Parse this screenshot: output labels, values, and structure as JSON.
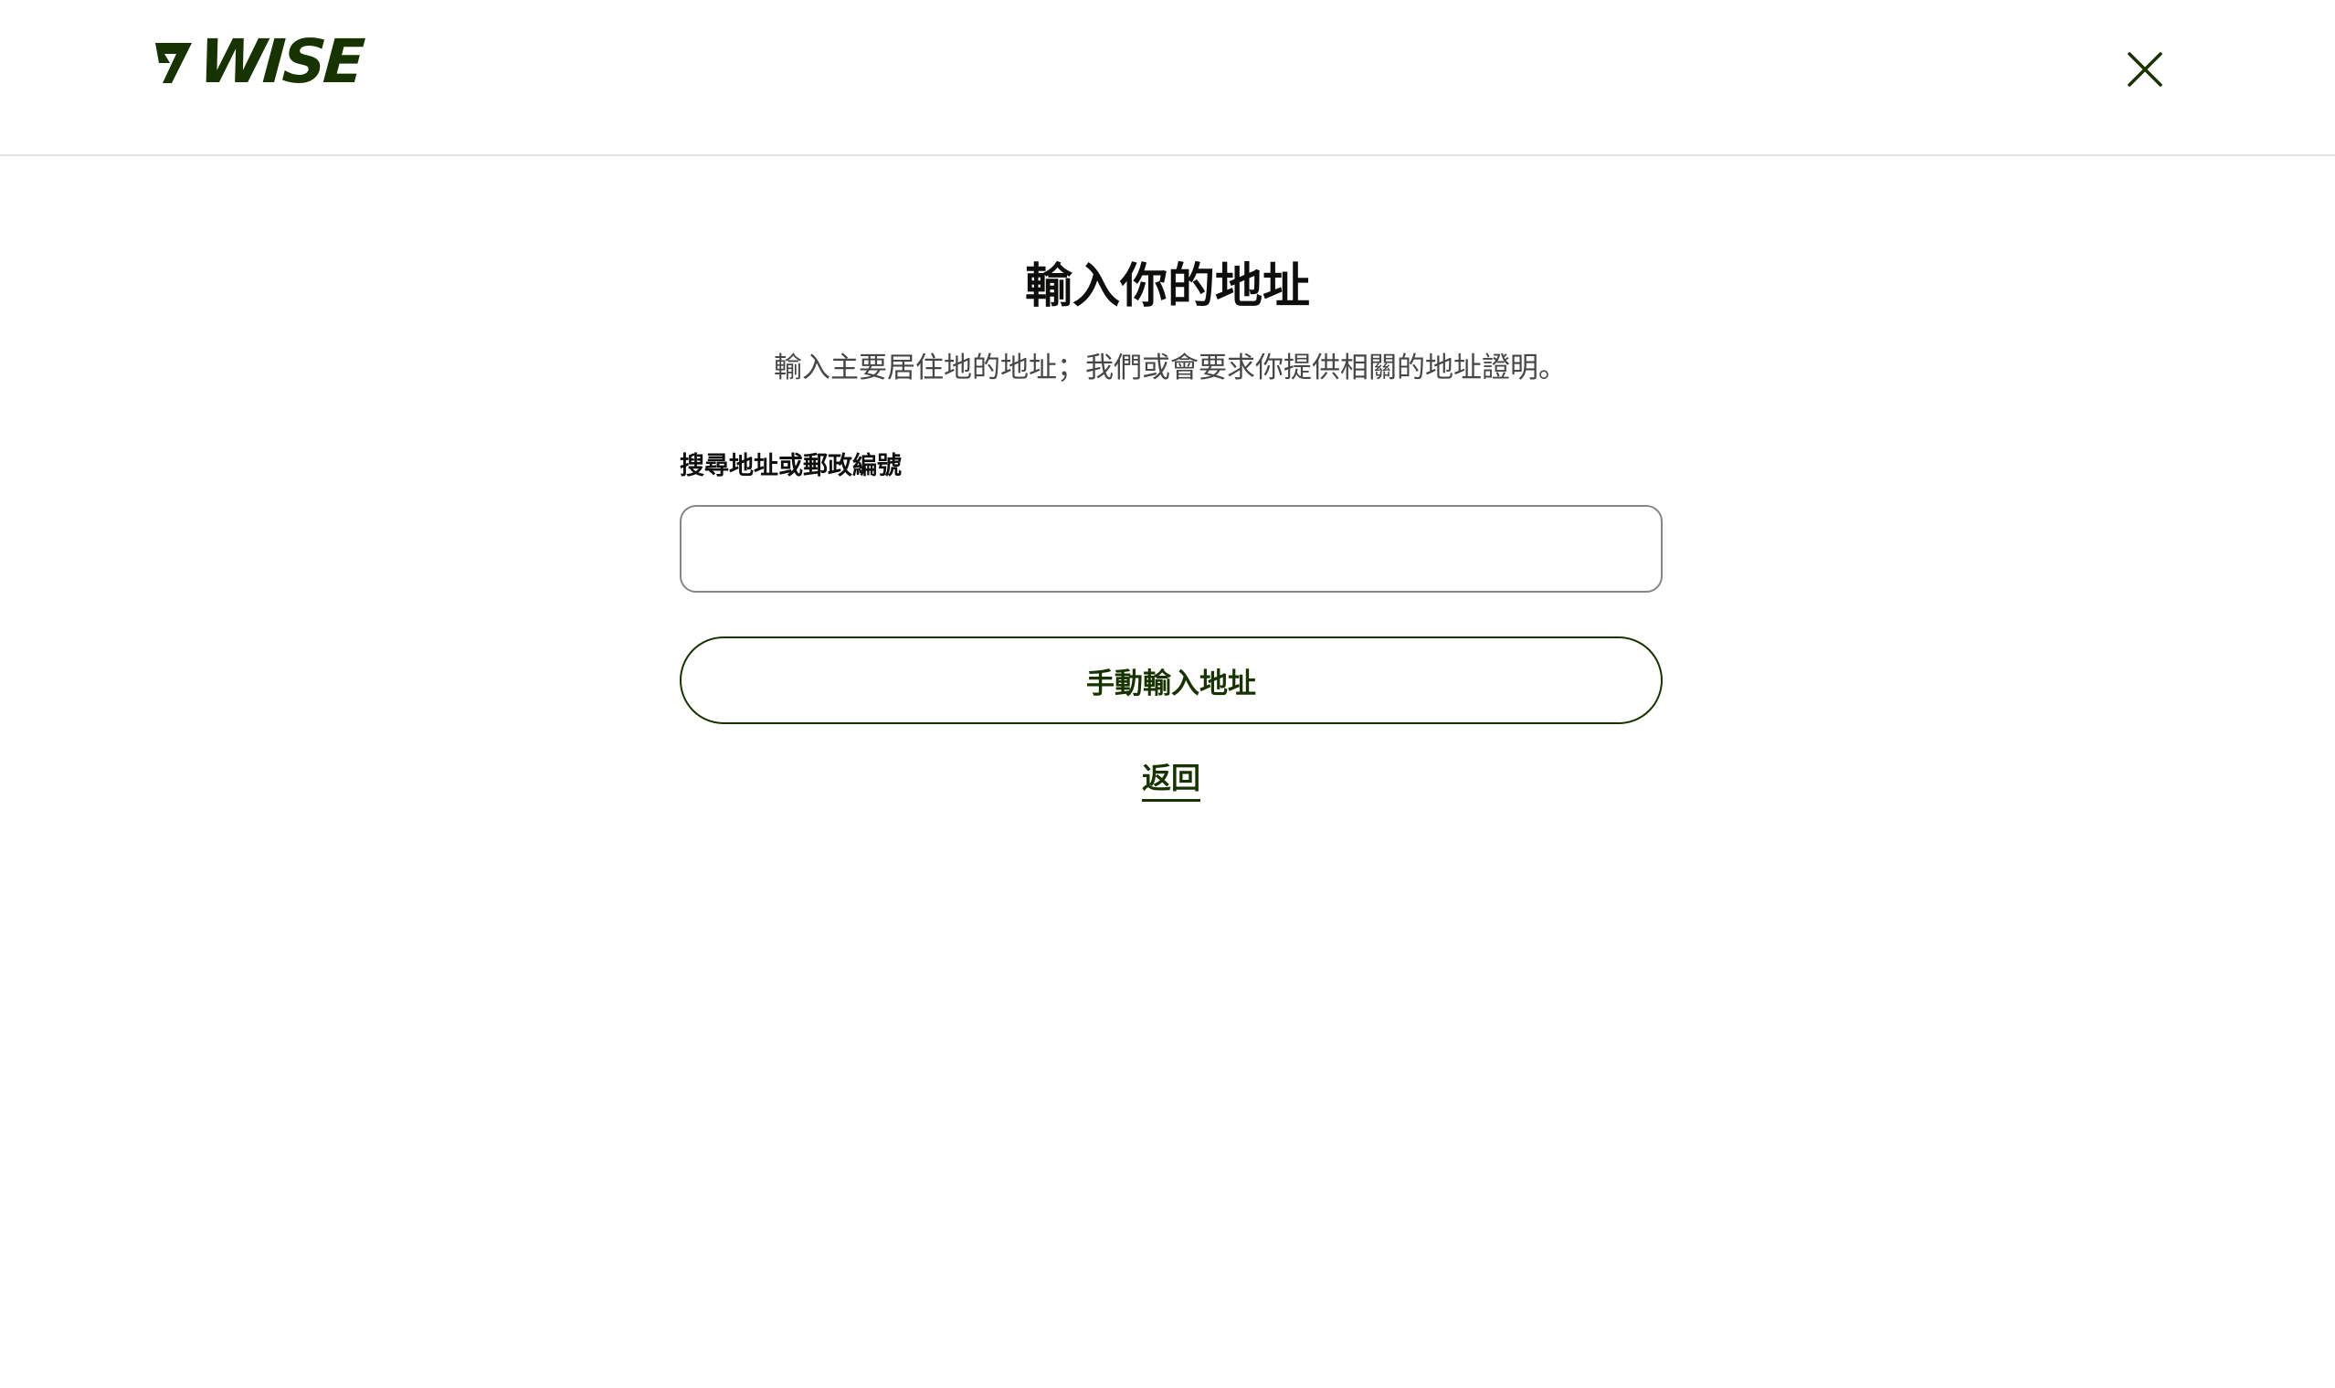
{
  "header": {
    "logo_text": "WISE",
    "brand_color": "#163300",
    "close_icon": "close-icon"
  },
  "main": {
    "title": "輸入你的地址",
    "subtitle": "輸入主要居住地的地址；我們或會要求你提供相關的地址證明。",
    "search": {
      "label": "搜尋地址或郵政編號",
      "value": "",
      "placeholder": ""
    },
    "manual_button_label": "手動輸入地址",
    "back_link_label": "返回"
  }
}
